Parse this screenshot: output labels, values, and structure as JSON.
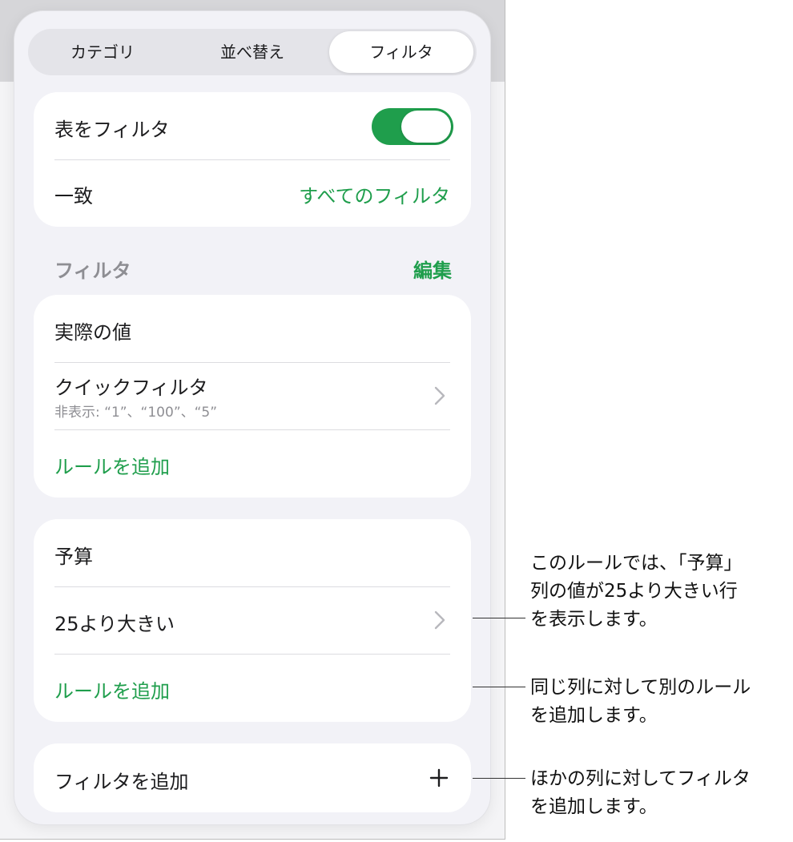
{
  "segments": [
    "カテゴリ",
    "並べ替え",
    "フィルタ"
  ],
  "selected_segment": "フィルタ",
  "table_filter": {
    "label": "表をフィルタ",
    "toggle_on": true,
    "match_label": "一致",
    "match_value": "すべてのフィルタ"
  },
  "filters_section": {
    "title": "フィルタ",
    "edit": "編集"
  },
  "filter_groups": [
    {
      "column": "実際の値",
      "rule": "クイックフィルタ",
      "rule_detail": "非表示: “1”、“100”、“5”",
      "add_rule": "ルールを追加"
    },
    {
      "column": "予算",
      "rule": "25より大きい",
      "add_rule": "ルールを追加"
    }
  ],
  "add_filter": {
    "label": "フィルタを追加",
    "icon": "plus-icon"
  },
  "callouts": [
    {
      "lines": [
        "このルールでは、「予算」",
        "列の値が25より大きい行",
        "を表示します。"
      ]
    },
    {
      "lines": [
        "同じ列に対して別のルール",
        "を追加します。"
      ]
    },
    {
      "lines": [
        "ほかの列に対してフィルタ",
        "を追加します。"
      ]
    }
  ],
  "colors": {
    "accent": "#1f9e4c",
    "secondary_text": "#8e8e93",
    "panel_bg": "#f2f2f7"
  }
}
